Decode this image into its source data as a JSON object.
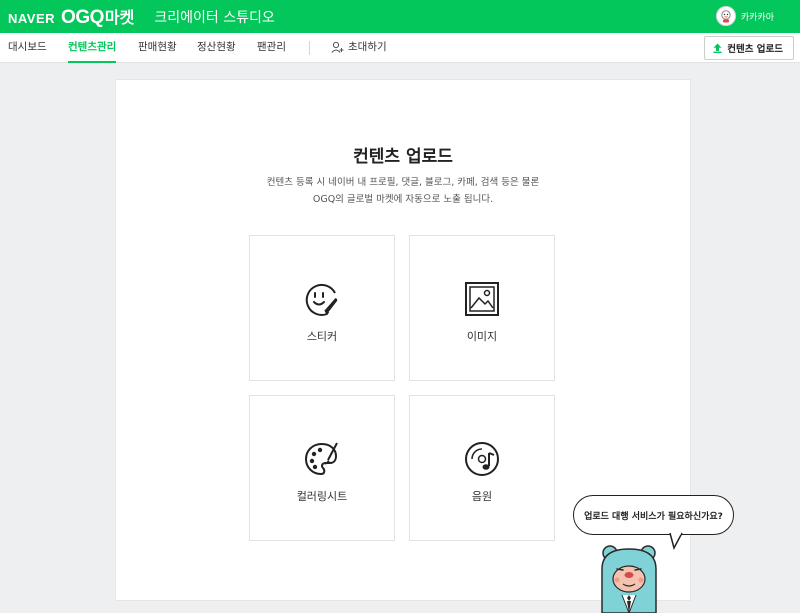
{
  "header": {
    "brand_naver": "NAVER",
    "brand_ogq": "OGQ",
    "brand_market": "마켓",
    "studio_title": "크리에이터 스튜디오",
    "user_name": "카카카아",
    "bg_color": "#03c75a"
  },
  "nav": {
    "items": [
      {
        "label": "대시보드",
        "active": false
      },
      {
        "label": "컨텐츠관리",
        "active": true
      },
      {
        "label": "판매현황",
        "active": false
      },
      {
        "label": "정산현황",
        "active": false
      },
      {
        "label": "팬관리",
        "active": false
      }
    ],
    "invite_label": "초대하기",
    "upload_label": "컨텐츠 업로드"
  },
  "main": {
    "title": "컨텐츠 업로드",
    "description_line1": "컨텐츠 등록 시 네이버 내 프로필, 댓글, 블로그, 카페, 검색 등은 물론",
    "description_line2": "OGQ의 글로벌 마켓에 자동으로 노출 됩니다.",
    "tiles": [
      {
        "label": "스티커",
        "icon": "sticker-icon"
      },
      {
        "label": "이미지",
        "icon": "image-icon"
      },
      {
        "label": "컬러링시트",
        "icon": "palette-icon"
      },
      {
        "label": "음원",
        "icon": "music-disc-icon"
      }
    ]
  },
  "help": {
    "bubble_text": "업로드 대행 서비스가 필요하신가요?",
    "mascot_icon": "bear-mascot-icon",
    "mascot_color": "#7fd3d6"
  }
}
